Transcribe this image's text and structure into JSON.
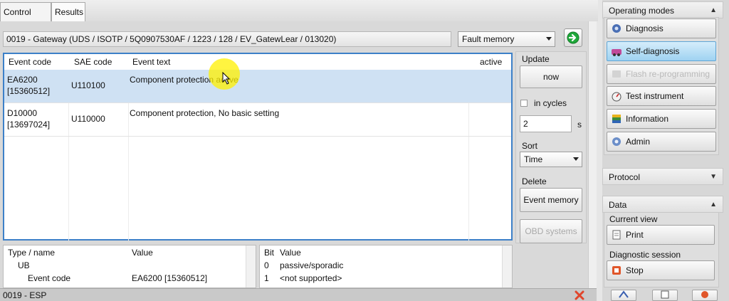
{
  "tabs": [
    {
      "label": "Control units"
    },
    {
      "label": "Results"
    }
  ],
  "path": "0019 - Gateway  (UDS / ISOTP / 5Q0907530AF / 1223 / 128 / EV_GatewLear / 013020)",
  "mode_select": "Fault memory",
  "table": {
    "headers": {
      "event_code": "Event code",
      "sae_code": "SAE code",
      "event_text": "Event text",
      "active": "active"
    },
    "rows": [
      {
        "code_line1": "EA6200",
        "code_line2": "[15360512]",
        "sae": "U110100",
        "text": "Component protection active",
        "active": ""
      },
      {
        "code_line1": "D10000",
        "code_line2": "[13697024]",
        "sae": "U110000",
        "text": "Component protection, No basic setting",
        "active": ""
      }
    ]
  },
  "update": {
    "title": "Update",
    "now": "now",
    "in_cycles": "in cycles",
    "interval_value": "2",
    "unit": "s"
  },
  "sort": {
    "title": "Sort",
    "value": "Time"
  },
  "delete": {
    "title": "Delete",
    "event_memory": "Event memory",
    "obd_systems": "OBD systems"
  },
  "lower_left": {
    "headers": {
      "name": "Type / name",
      "value": "Value"
    },
    "rows": [
      {
        "name": "UB",
        "value": ""
      },
      {
        "name": "Event code",
        "value": "EA6200 [15360512]"
      }
    ]
  },
  "lower_right": {
    "headers": {
      "bit": "Bit",
      "value": "Value"
    },
    "rows": [
      {
        "bit": "0",
        "value": "passive/sporadic"
      },
      {
        "bit": "1",
        "value": "<not supported>"
      }
    ]
  },
  "status_partial": "0019 - ESP",
  "sidebar": {
    "operating_modes": {
      "title": "Operating modes",
      "items": [
        {
          "label": "Diagnosis",
          "state": "normal"
        },
        {
          "label": "Self-diagnosis",
          "state": "active"
        },
        {
          "label": "Flash re-programming",
          "state": "disabled"
        },
        {
          "label": "Test instrument",
          "state": "normal"
        },
        {
          "label": "Information",
          "state": "normal"
        },
        {
          "label": "Admin",
          "state": "normal"
        }
      ]
    },
    "protocol": {
      "title": "Protocol"
    },
    "data": {
      "title": "Data",
      "current_view": "Current view",
      "print": "Print",
      "diagnostic_session": "Diagnostic session",
      "stop": "Stop"
    }
  },
  "colors": {
    "accent_blue": "#3d80c8",
    "selected_row": "#cfe1f3",
    "active_button": "#9fd2f1",
    "go_green": "#1fa83a"
  }
}
